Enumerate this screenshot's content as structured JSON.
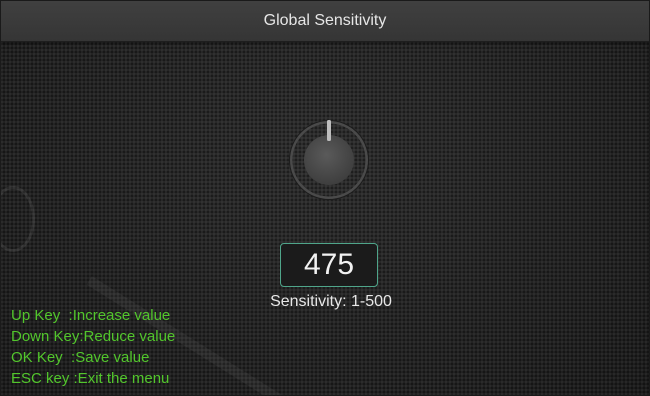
{
  "window": {
    "title": "Global Sensitivity"
  },
  "sensitivity": {
    "value": "475",
    "range_label": "Sensitivity: 1-500"
  },
  "help": [
    "Up Key  :Increase value",
    "Down Key:Reduce value",
    "OK Key  :Save value",
    "ESC key :Exit the menu"
  ],
  "colors": {
    "accent": "#4fa58a",
    "help_text": "#52c62c",
    "background": "#262626"
  },
  "icons": {
    "knob": "power-knob-icon"
  }
}
